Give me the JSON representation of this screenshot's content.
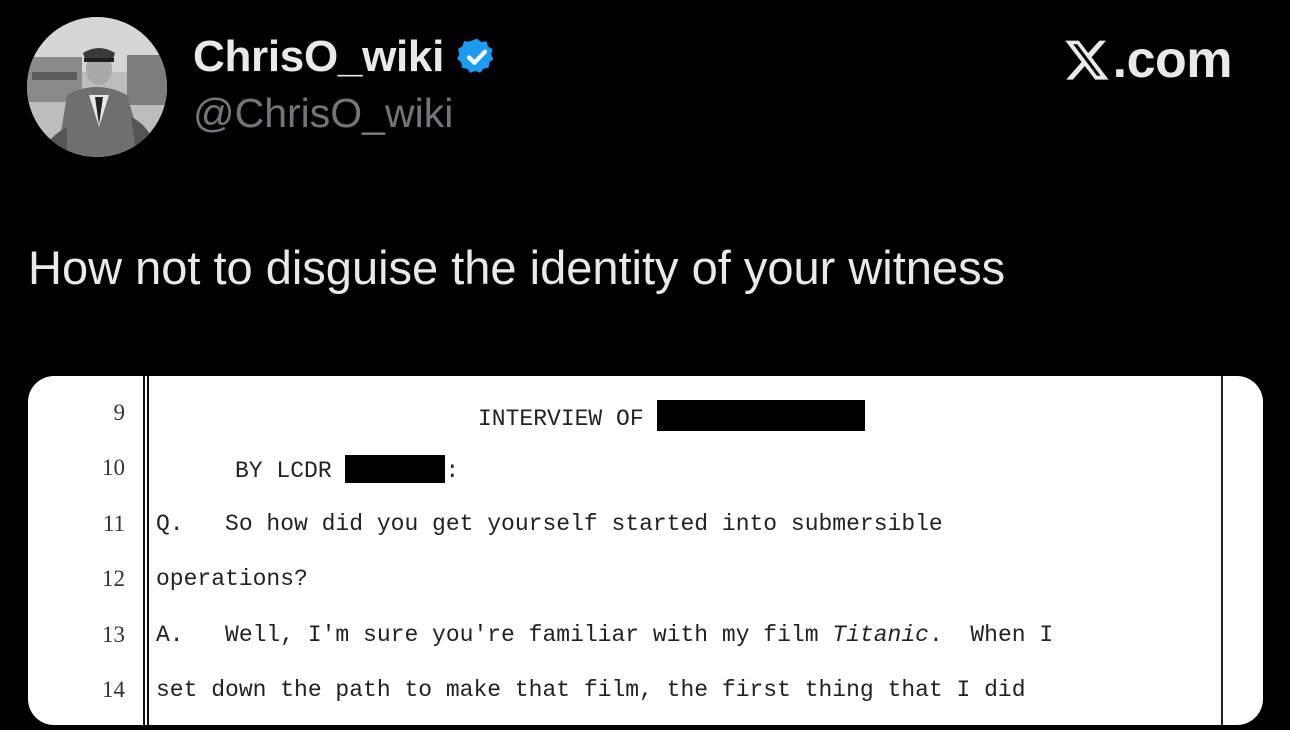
{
  "header": {
    "display_name": "ChrisO_wiki",
    "handle": "@ChrisO_wiki",
    "brand_text": ".com",
    "verified_color": "#1d9bf0",
    "avatar_icon": "profile-photo-naval-officer",
    "brand_icon": "x-logo-icon"
  },
  "tweet": {
    "text": "How not to disguise the identity of your witness"
  },
  "transcript": {
    "lines": [
      {
        "num": "9",
        "pre": "INTERVIEW OF ",
        "emph": "",
        "post": ""
      },
      {
        "num": "10",
        "pre": "BY LCDR ",
        "emph": "",
        "post": ":"
      },
      {
        "num": "11",
        "pre": "Q.   So how did you get yourself started into submersible",
        "emph": "",
        "post": ""
      },
      {
        "num": "12",
        "pre": "operations?",
        "emph": "",
        "post": ""
      },
      {
        "num": "13",
        "pre": "A.   Well, I'm sure you're familiar with my film ",
        "emph": "Titanic",
        "post": ".  When I"
      },
      {
        "num": "14",
        "pre": "set down the path to make that film, the first thing that I did",
        "emph": "",
        "post": ""
      }
    ]
  }
}
